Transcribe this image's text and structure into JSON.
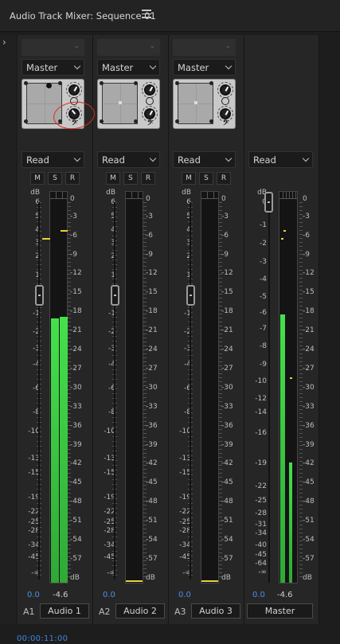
{
  "panel": {
    "title": "Audio Track Mixer: Sequence 01",
    "timecode": "00:00:11:00"
  },
  "output_label": "Master",
  "automation_mode": "Read",
  "buttons": {
    "mute": "M",
    "solo": "S",
    "record": "R"
  },
  "fader_scale": [
    "dB",
    "6",
    "5",
    "4",
    "3",
    "2",
    "1",
    "0",
    "-1",
    "-2",
    "-3",
    "-4",
    "-6",
    "-8",
    "-10",
    "-13",
    "-15",
    "-19",
    "-22",
    "-25",
    "-28",
    "-34",
    "-45",
    "-∞"
  ],
  "meter_scale": [
    "0",
    "-3",
    "-6",
    "-9",
    "-12",
    "-15",
    "-18",
    "-21",
    "-24",
    "-27",
    "-30",
    "-33",
    "-36",
    "-39",
    "-42",
    "-45",
    "-48",
    "-51",
    "-54",
    "-57",
    "dB"
  ],
  "master_fader_scale": [
    "dB",
    "0",
    "-1",
    "-2",
    "-3",
    "-4",
    "-5",
    "-6",
    "-7",
    "-8",
    "-9",
    "-10",
    "-12",
    "-14",
    "-16",
    "-19",
    "-22",
    "-25",
    "-28",
    "-31",
    "-34",
    "-40",
    "-45",
    "-64",
    "-∞"
  ],
  "tracks": [
    {
      "id": "A1",
      "name": "Audio 1",
      "volume": "0.0",
      "peak": "-4.6",
      "meter_level_db": -13,
      "peak_hold_db": -3.5
    },
    {
      "id": "A2",
      "name": "Audio 2",
      "volume": "0.0",
      "peak": "",
      "meter_level_db": null
    },
    {
      "id": "A3",
      "name": "Audio 3",
      "volume": "0.0",
      "peak": "",
      "meter_level_db": null
    }
  ],
  "master": {
    "name": "Master",
    "volume": "0.0",
    "peak": "-4.6",
    "meter_level_db": -13
  },
  "colors": {
    "meter_green": "#3fd845",
    "peak_yellow": "#e7d33a",
    "timecode_blue": "#3b86e0",
    "annotation_red": "#e02b1b"
  }
}
